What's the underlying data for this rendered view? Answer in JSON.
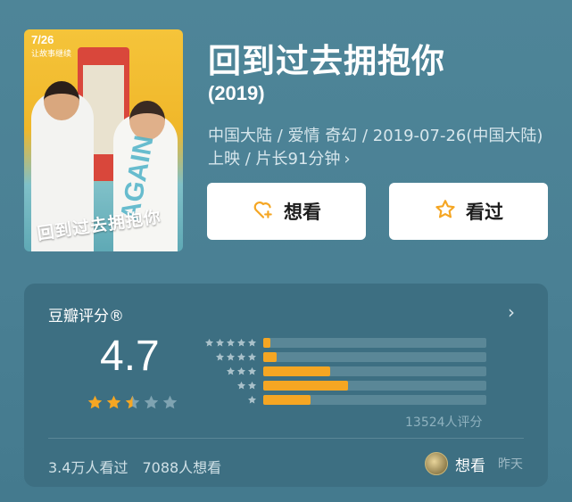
{
  "poster": {
    "date": "7/26",
    "tagline": "让故事继续",
    "title": "回到过去拥抱你",
    "overlay_word": "AGAIN"
  },
  "movie": {
    "title": "回到过去拥抱你",
    "year": "(2019)",
    "meta": "中国大陆 / 爱情 奇幻 / 2019-07-26(中国大陆)上映 / 片长91分钟",
    "meta_chevron": "›"
  },
  "actions": {
    "want_label": "想看",
    "seen_label": "看过",
    "accent_color": "#f5a623"
  },
  "rating": {
    "header": "豆瓣评分®",
    "chevron": "›",
    "score": "4.7",
    "score_stars": 2.5,
    "distribution": [
      {
        "stars": 5,
        "fraction": 0.03
      },
      {
        "stars": 4,
        "fraction": 0.06
      },
      {
        "stars": 3,
        "fraction": 0.3
      },
      {
        "stars": 2,
        "fraction": 0.38
      },
      {
        "stars": 1,
        "fraction": 0.21
      }
    ],
    "votes": "13524人评分",
    "seen_count": "3.4万人看过",
    "want_count": "7088人想看",
    "friend_status": "想看",
    "friend_time": "昨天"
  },
  "colors": {
    "background": "#4b8195",
    "card": "#3d6f82",
    "bar_fill": "#f5a623",
    "bar_track": "#5a8797",
    "star_filled": "#f5a623",
    "star_empty": "#7fa3b1"
  }
}
